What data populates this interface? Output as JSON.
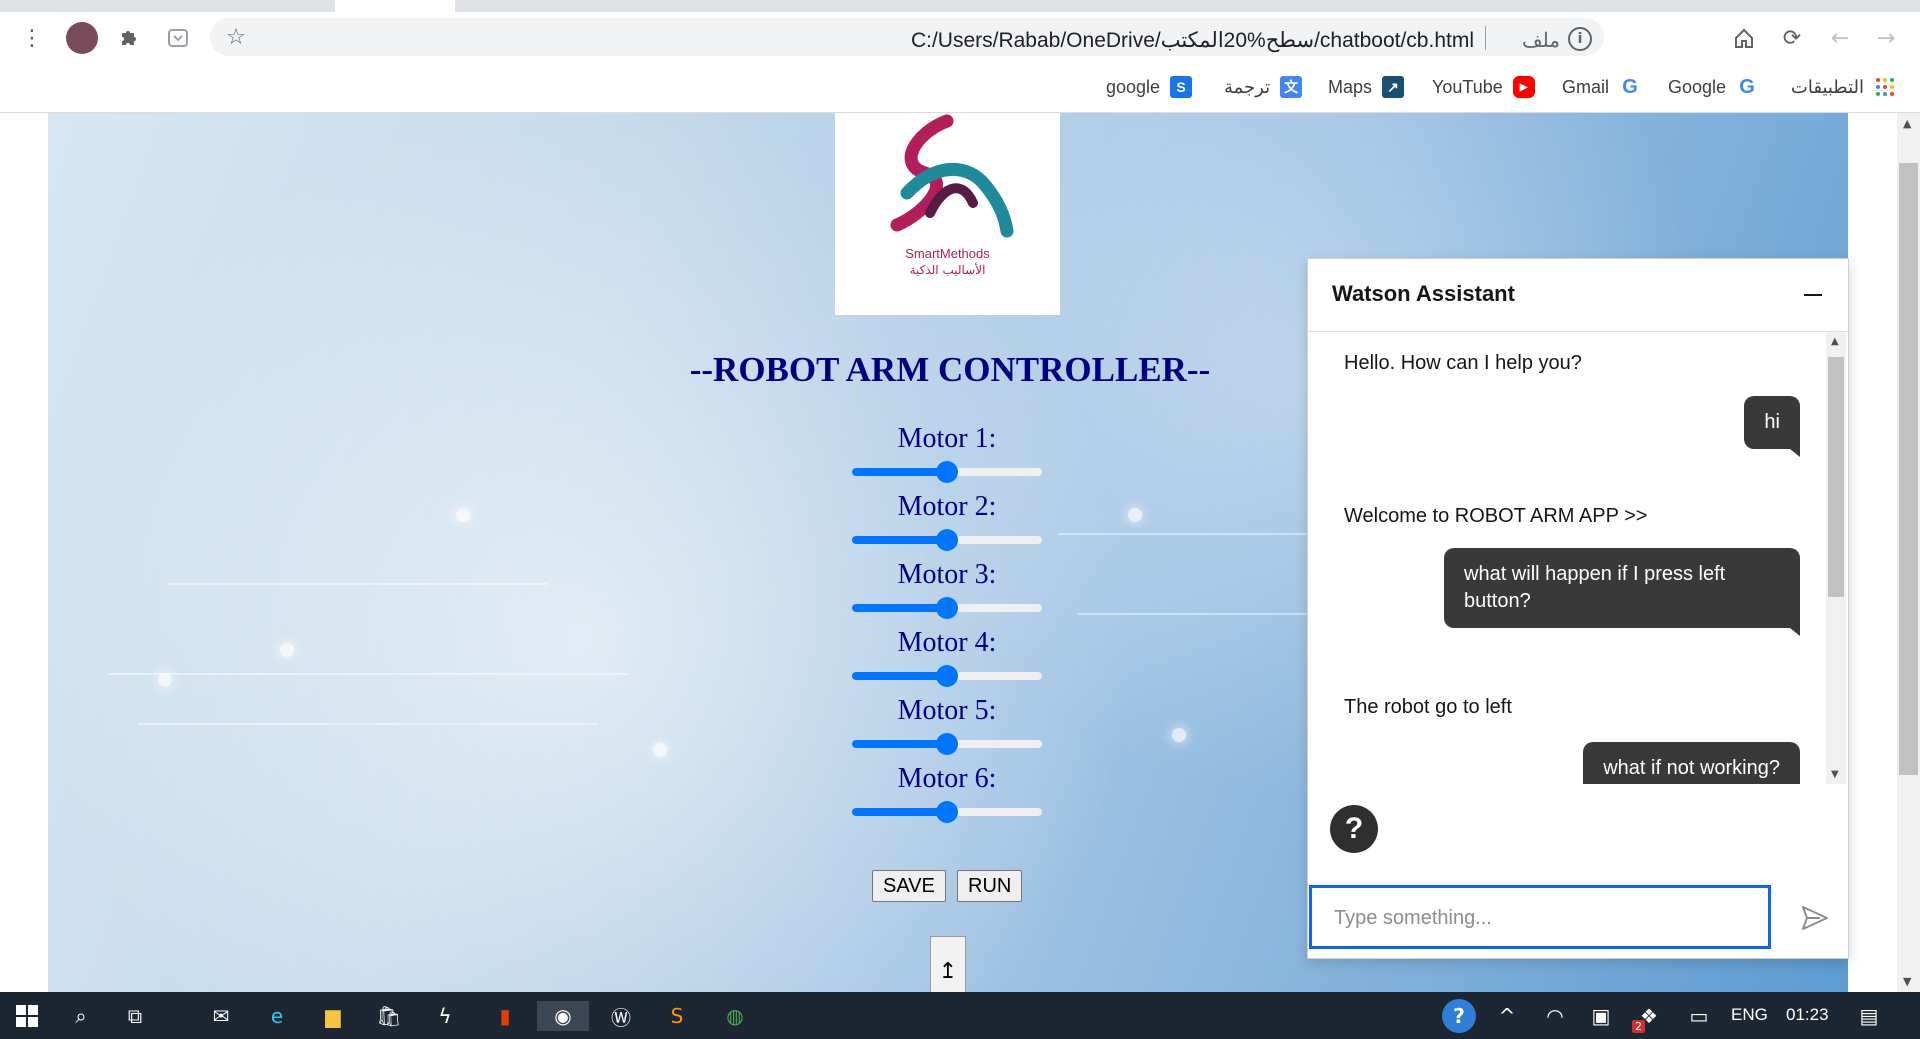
{
  "browser": {
    "url": "C:/Users/Rabab/OneDrive/سطح%20المكتب/chatboot/cb.html",
    "url_scheme_label": "ملف",
    "bookmarks": [
      {
        "label": "التطبيقات",
        "icon": "apps-grid-icon"
      },
      {
        "label": "Google",
        "icon": "google-icon"
      },
      {
        "label": "Gmail",
        "icon": "google-icon"
      },
      {
        "label": "YouTube",
        "icon": "youtube-icon"
      },
      {
        "label": "Maps",
        "icon": "maps-icon"
      },
      {
        "label": "ترجمة",
        "icon": "translate-icon"
      },
      {
        "label": "google",
        "icon": "s-icon"
      }
    ]
  },
  "page": {
    "logo_name": "SmartMethods",
    "logo_name_ar": "الأساليب الذكية",
    "title": "--ROBOT ARM CONTROLLER--",
    "motors": [
      {
        "label": "Motor 1:",
        "value": 0.5
      },
      {
        "label": "Motor 2:",
        "value": 0.5
      },
      {
        "label": "Motor 3:",
        "value": 0.5
      },
      {
        "label": "Motor 4:",
        "value": 0.5
      },
      {
        "label": "Motor 5:",
        "value": 0.5
      },
      {
        "label": "Motor 6:",
        "value": 0.5
      }
    ],
    "save_label": "SAVE",
    "run_label": "RUN",
    "updown_glyph": "↥"
  },
  "watson": {
    "title": "Watson Assistant",
    "messages": [
      {
        "from": "bot",
        "text": "Hello. How can I help you?"
      },
      {
        "from": "user",
        "text": "hi"
      },
      {
        "from": "bot",
        "text": "Welcome to ROBOT ARM APP >>"
      },
      {
        "from": "user",
        "text": "what will happen if I press left button?"
      },
      {
        "from": "bot",
        "text": "The robot go to left"
      },
      {
        "from": "user",
        "text": "what if not working?"
      }
    ],
    "help_glyph": "?",
    "input_placeholder": "Type something..."
  },
  "taskbar": {
    "language": "ENG",
    "time": "01:23",
    "dropbox_badge": "2"
  },
  "colors": {
    "title_navy": "#000080",
    "slider_blue": "#0075ff",
    "watson_focus": "#0f62fe",
    "bubble_dark": "#393939",
    "taskbar": "#1d2633"
  }
}
